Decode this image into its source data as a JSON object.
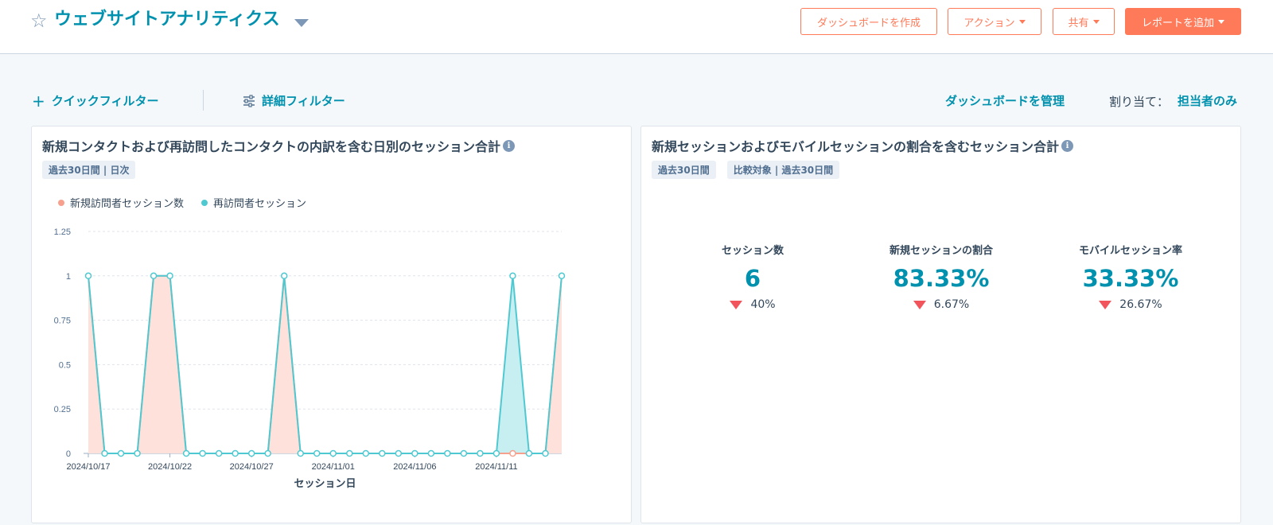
{
  "header": {
    "title": "ウェブサイトアナリティクス",
    "buttons": {
      "create_dashboard": "ダッシュボードを作成",
      "actions": "アクション",
      "share": "共有",
      "add_report": "レポートを追加"
    }
  },
  "filters": {
    "quick": "クイックフィルター",
    "advanced": "詳細フィルター",
    "manage": "ダッシュボードを管理",
    "assign_label": "割り当て：",
    "assign_value": "担当者のみ"
  },
  "colors": {
    "accent": "#0091ae",
    "cta": "#ff7a59",
    "new_series": "#f8a08e",
    "return_series": "#4fc9d1",
    "decrease": "#f2545b"
  },
  "report1": {
    "title": "新規コンタクトおよび再訪問したコンタクトの内訳を含む日別のセッション合計",
    "tags": [
      "過去30日間 | 日次"
    ],
    "chart_data": {
      "type": "area",
      "x": [
        "2024/10/17",
        "2024/10/18",
        "2024/10/19",
        "2024/10/20",
        "2024/10/21",
        "2024/10/22",
        "2024/10/23",
        "2024/10/24",
        "2024/10/25",
        "2024/10/26",
        "2024/10/27",
        "2024/10/28",
        "2024/10/29",
        "2024/10/30",
        "2024/10/31",
        "2024/11/01",
        "2024/11/02",
        "2024/11/03",
        "2024/11/04",
        "2024/11/05",
        "2024/11/06",
        "2024/11/07",
        "2024/11/08",
        "2024/11/09",
        "2024/11/10",
        "2024/11/11",
        "2024/11/12",
        "2024/11/13",
        "2024/11/14",
        "2024/11/15"
      ],
      "x_ticks": [
        "2024/10/17",
        "2024/10/22",
        "2024/10/27",
        "2024/11/01",
        "2024/11/06",
        "2024/11/11"
      ],
      "series": [
        {
          "name": "新規訪問者セッション数",
          "values": [
            1,
            0,
            0,
            0,
            1,
            1,
            0,
            0,
            0,
            0,
            0,
            0,
            1,
            0,
            0,
            0,
            0,
            0,
            0,
            0,
            0,
            0,
            0,
            0,
            0,
            0,
            0,
            0,
            0,
            1
          ]
        },
        {
          "name": "再訪問者セッション",
          "values": [
            0,
            0,
            0,
            0,
            0,
            0,
            0,
            0,
            0,
            0,
            0,
            0,
            0,
            0,
            0,
            0,
            0,
            0,
            0,
            0,
            0,
            0,
            0,
            0,
            0,
            0,
            1,
            0,
            0,
            0
          ]
        }
      ],
      "y_ticks": [
        "0",
        "0.25",
        "0.5",
        "0.75",
        "1",
        "1.25"
      ],
      "ylim": [
        0,
        1.25
      ],
      "xlabel": "セッション日",
      "ylabel": "",
      "stacked": true,
      "grid": true,
      "legend": "top-left"
    }
  },
  "report2": {
    "title": "新規セッションおよびモバイルセッションの割合を含むセッション合計",
    "tags": [
      "過去30日間",
      "比較対象 | 過去30日間"
    ],
    "kpis": [
      {
        "label": "セッション数",
        "value": "6",
        "change": "40%",
        "direction": "down"
      },
      {
        "label": "新規セッションの割合",
        "value": "83.33%",
        "change": "6.67%",
        "direction": "down"
      },
      {
        "label": "モバイルセッション率",
        "value": "33.33%",
        "change": "26.67%",
        "direction": "down"
      }
    ]
  }
}
